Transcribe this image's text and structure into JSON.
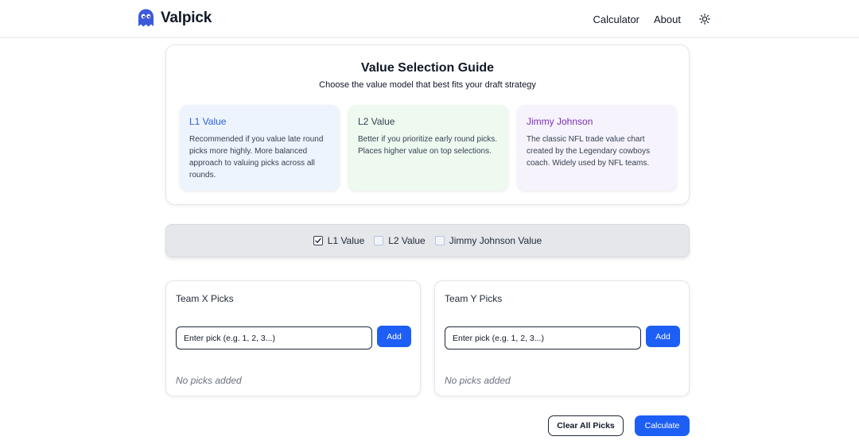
{
  "app": {
    "name": "Valpick",
    "logo_icon": "ghost-icon",
    "accent_color": "#1d5ff5"
  },
  "nav": {
    "items": [
      {
        "label": "Calculator"
      },
      {
        "label": "About"
      }
    ],
    "theme_icon": "sun-icon"
  },
  "guide": {
    "title": "Value Selection Guide",
    "subtitle": "Choose the value model that best fits your draft strategy",
    "models": [
      {
        "name": "L1 Value",
        "description": "Recommended if you value late round picks more highly. More balanced approach to valuing picks across all rounds.",
        "color": "#2f5fd9",
        "background": "#eef4fd"
      },
      {
        "name": "L2 Value",
        "description": "Better if you prioritize early round picks. Places higher value on top selections.",
        "color": "#374151",
        "background": "#eef9f0"
      },
      {
        "name": "Jimmy Johnson",
        "description": "The classic NFL trade value chart created by the Legendary cowboys coach. Widely used by NFL teams.",
        "color": "#7e2fb5",
        "background": "#f6f3fc"
      }
    ]
  },
  "selector": {
    "options": [
      {
        "label": "L1 Value",
        "checked": true
      },
      {
        "label": "L2 Value",
        "checked": false
      },
      {
        "label": "Jimmy Johnson Value",
        "checked": false
      }
    ]
  },
  "teams": [
    {
      "title": "Team X Picks",
      "input_placeholder": "Enter pick (e.g. 1, 2, 3...)",
      "add_label": "Add",
      "empty_text": "No picks added"
    },
    {
      "title": "Team Y Picks",
      "input_placeholder": "Enter pick (e.g. 1, 2, 3...)",
      "add_label": "Add",
      "empty_text": "No picks added"
    }
  ],
  "actions": {
    "clear_label": "Clear All Picks",
    "calculate_label": "Calculate"
  }
}
